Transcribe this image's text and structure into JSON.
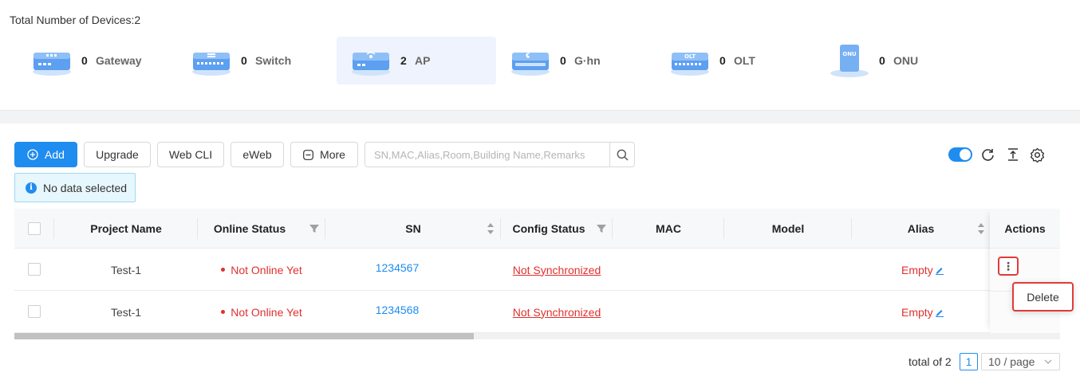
{
  "summary": {
    "total_label": "Total Number of Devices:2",
    "devices": [
      {
        "count": "0",
        "label": "Gateway",
        "icon": "gateway-icon",
        "active": false
      },
      {
        "count": "0",
        "label": "Switch",
        "icon": "switch-icon",
        "active": false
      },
      {
        "count": "2",
        "label": "AP",
        "icon": "ap-icon",
        "active": true
      },
      {
        "count": "0",
        "label": "G·hn",
        "icon": "ghn-icon",
        "active": false
      },
      {
        "count": "0",
        "label": "OLT",
        "icon": "olt-icon",
        "active": false
      },
      {
        "count": "0",
        "label": "ONU",
        "icon": "onu-icon",
        "active": false
      }
    ],
    "olt_icon_text": "OLT",
    "onu_icon_text": "ONU"
  },
  "toolbar": {
    "add_label": "Add",
    "upgrade_label": "Upgrade",
    "webcli_label": "Web CLI",
    "eweb_label": "eWeb",
    "more_label": "More",
    "search_placeholder": "SN,MAC,Alias,Room,Building Name,Remarks",
    "toggle_on": true
  },
  "info": {
    "message": "No data selected"
  },
  "table": {
    "headers": {
      "project": "Project Name",
      "online": "Online Status",
      "sn": "SN",
      "config": "Config Status",
      "mac": "MAC",
      "model": "Model",
      "alias": "Alias",
      "actions": "Actions"
    },
    "rows": [
      {
        "project": "Test-1",
        "online": "Not Online Yet",
        "sn": "1234567",
        "config": "Not Synchronized",
        "mac": "",
        "model": "",
        "alias": "Empty"
      },
      {
        "project": "Test-1",
        "online": "Not Online Yet",
        "sn": "1234568",
        "config": "Not Synchronized",
        "mac": "",
        "model": "",
        "alias": "Empty"
      }
    ],
    "more_glyph": "⋮",
    "menu_delete": "Delete"
  },
  "pager": {
    "total": "total of 2",
    "current_page": "1",
    "page_size": "10 / page"
  },
  "colors": {
    "accent": "#1f8cf0",
    "danger": "#e0302e",
    "highlight": "#e03b3b"
  }
}
